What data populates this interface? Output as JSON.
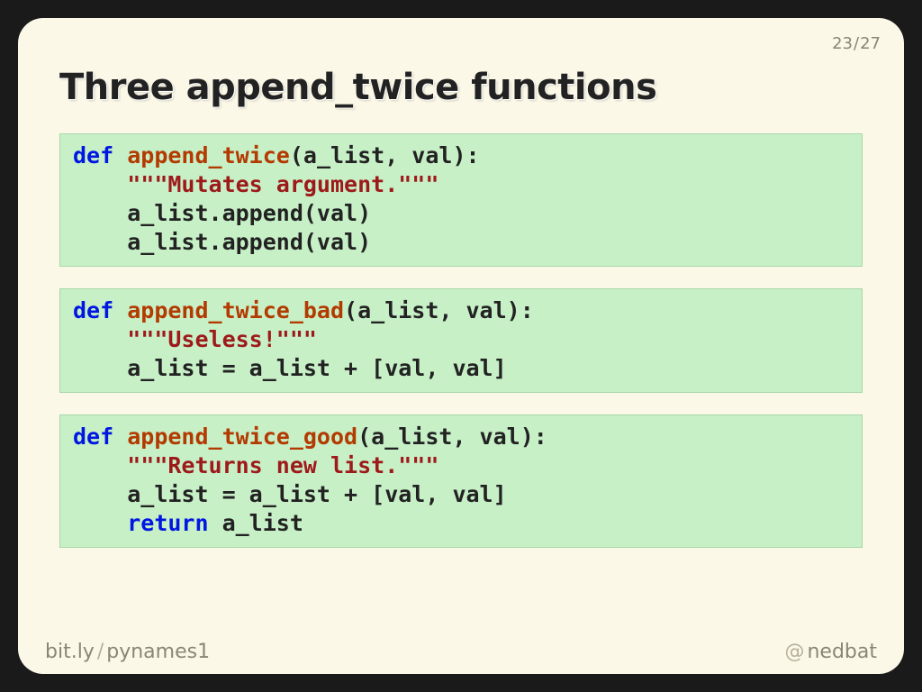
{
  "page": {
    "current": "23",
    "total": "27"
  },
  "title": "Three append_twice functions",
  "code": {
    "b1": {
      "def": "def",
      "name": "append_twice",
      "sig": "(a_list, val):",
      "doc": "\"\"\"Mutates argument.\"\"\"",
      "l1": "a_list.append(val)",
      "l2": "a_list.append(val)"
    },
    "b2": {
      "def": "def",
      "name": "append_twice_bad",
      "sig": "(a_list, val):",
      "doc": "\"\"\"Useless!\"\"\"",
      "l1": "a_list = a_list + [val, val]"
    },
    "b3": {
      "def": "def",
      "name": "append_twice_good",
      "sig": "(a_list, val):",
      "doc": "\"\"\"Returns new list.\"\"\"",
      "l1": "a_list = a_list + [val, val]",
      "ret": "return",
      "retv": " a_list"
    }
  },
  "footer": {
    "link_host": "bit.ly",
    "link_sep": "/",
    "link_path": "pynames1",
    "at": "@",
    "handle": "nedbat"
  }
}
